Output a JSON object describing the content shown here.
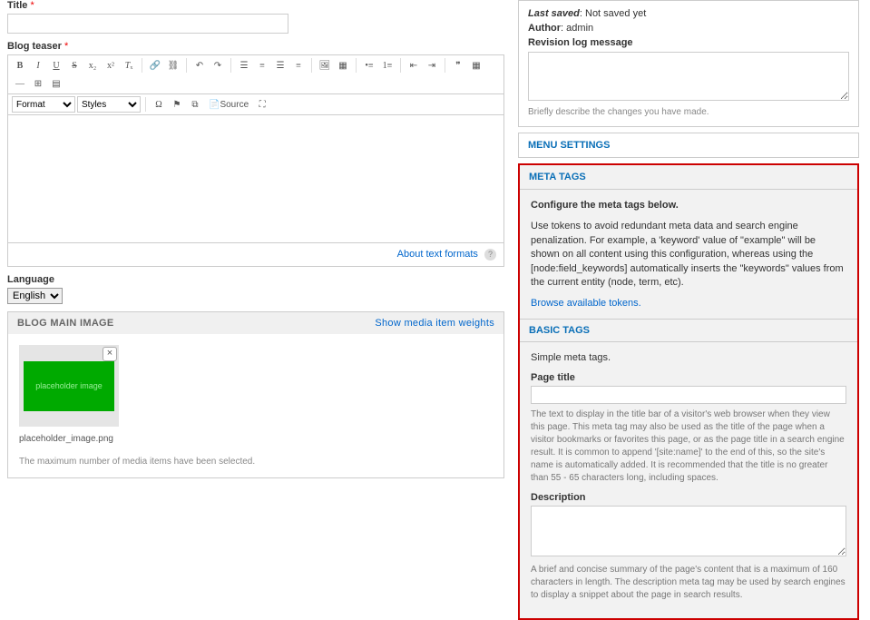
{
  "left": {
    "title_label": "Title",
    "teaser_label": "Blog teaser",
    "format_sel": "Format",
    "styles_sel": "Styles",
    "source_label": "Source",
    "about_text": "About text formats",
    "lang_label": "Language",
    "lang_value": "English",
    "main_image_head": "BLOG MAIN IMAGE",
    "show_weights": "Show media item weights",
    "thumb_caption": "placeholder image",
    "thumb_filename": "placeholder_image.png",
    "max_msg": "The maximum number of media items have been selected."
  },
  "right": {
    "last_saved_label": "Last saved",
    "last_saved_val": "Not saved yet",
    "author_label": "Author",
    "author_val": "admin",
    "rev_label": "Revision log message",
    "rev_desc": "Briefly describe the changes you have made.",
    "menu_settings": "MENU SETTINGS",
    "meta_tags": "META TAGS",
    "meta_configure": "Configure the meta tags below.",
    "meta_tokens_help": "Use tokens to avoid redundant meta data and search engine penalization. For example, a 'keyword' value of \"example\" will be shown on all content using this configuration, whereas using the [node:field_keywords] automatically inserts the \"keywords\" values from the current entity (node, term, etc).",
    "browse_tokens": "Browse available tokens.",
    "basic_tags": "BASIC TAGS",
    "simple_meta": "Simple meta tags.",
    "page_title_label": "Page title",
    "page_title_help": "The text to display in the title bar of a visitor's web browser when they view this page. This meta tag may also be used as the title of the page when a visitor bookmarks or favorites this page, or as the page title in a search engine result. It is common to append '[site:name]' to the end of this, so the site's name is automatically added. It is recommended that the title is no greater than 55 - 65 characters long, including spaces.",
    "desc_label": "Description",
    "desc_help": "A brief and concise summary of the page's content that is a maximum of 160 characters in length. The description meta tag may be used by search engines to display a snippet about the page in search results."
  }
}
